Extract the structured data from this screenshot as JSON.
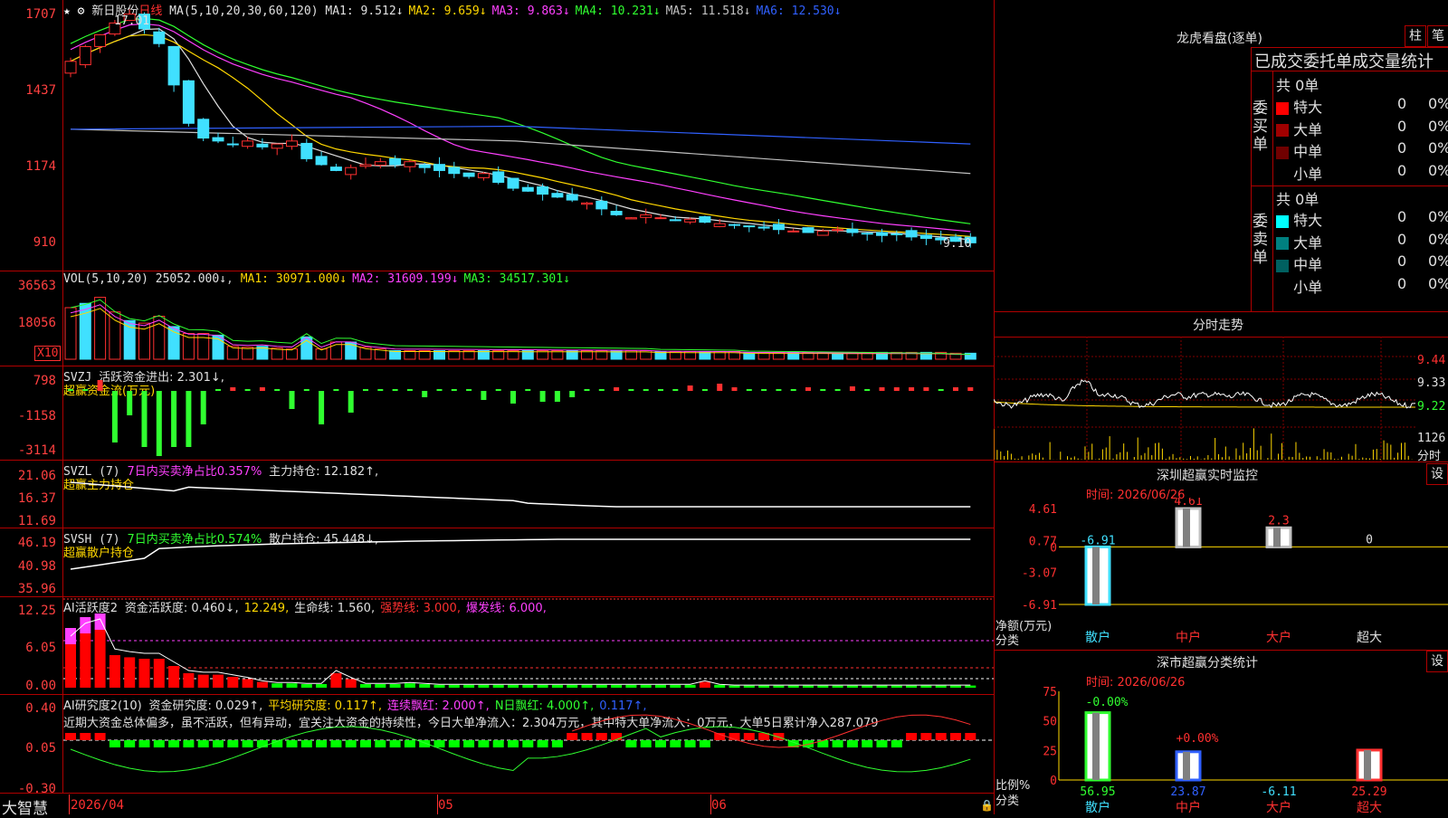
{
  "app_name": "大智慧",
  "stock": {
    "name": "新日股份",
    "period": "日线"
  },
  "kline": {
    "ma_params": "MA(5,10,20,30,60,120)",
    "ma_values": [
      {
        "label": "MA1:",
        "value": "9.512↓",
        "color": "#e0e0e0"
      },
      {
        "label": "MA2:",
        "value": "9.659↓",
        "color": "#ffd700"
      },
      {
        "label": "MA3:",
        "value": "9.863↓",
        "color": "#ff40ff"
      },
      {
        "label": "MA4:",
        "value": "10.231↓",
        "color": "#30ff30"
      },
      {
        "label": "MA5:",
        "value": "11.518↓",
        "color": "#c0c0c0"
      },
      {
        "label": "MA6:",
        "value": "12.530↓",
        "color": "#3060ff"
      }
    ],
    "y_ticks": [
      "1707",
      "1437",
      "1174",
      "910"
    ],
    "high_label": "17.01",
    "last_label": "9.10"
  },
  "vol": {
    "header": "VOL(5,10,20)",
    "value": "25052.000↓",
    "ma": [
      {
        "label": "MA1:",
        "value": "30971.000↓",
        "color": "#ffd700"
      },
      {
        "label": "MA2:",
        "value": "31609.199↓",
        "color": "#ff40ff"
      },
      {
        "label": "MA3:",
        "value": "34517.301↓",
        "color": "#30ff30"
      }
    ],
    "y_ticks": [
      "36563",
      "18056"
    ],
    "unit": "X10"
  },
  "svzj": {
    "header": "SVZJ",
    "desc": "活跃资金进出: 2.301↓,",
    "sub": "超赢资金流(万元)",
    "y_ticks": [
      "798",
      "-1158",
      "-3114"
    ]
  },
  "svzl": {
    "header": "SVZL (7)",
    "desc1": "7日内买卖净占比0.357%",
    "desc2": "主力持仓: 12.182↑,",
    "sub": "超赢主力持仓",
    "y_ticks": [
      "21.06",
      "16.37",
      "11.69"
    ]
  },
  "svsh": {
    "header": "SVSH (7)",
    "desc1": "7日内买卖净占比0.574%",
    "desc2": "散户持仓: 45.448↓,",
    "sub": "超赢散户持仓",
    "y_ticks": [
      "46.19",
      "40.98",
      "35.96"
    ]
  },
  "ai_active": {
    "header": "AI活跃度2",
    "items": [
      {
        "text": "资金活跃度: 0.460↓,",
        "color": "#e0e0e0"
      },
      {
        "text": "12.249,",
        "color": "#ffd700"
      },
      {
        "text": "生命线: 1.560,",
        "color": "#e0e0e0"
      },
      {
        "text": "强势线: 3.000,",
        "color": "#ff3030"
      },
      {
        "text": "爆发线: 6.000,",
        "color": "#ff40ff"
      }
    ],
    "y_ticks": [
      "12.25",
      "6.05",
      "0.00"
    ]
  },
  "ai_research": {
    "header": "AI研究度2(10)",
    "items": [
      {
        "text": "资金研究度: 0.029↑,",
        "color": "#e0e0e0"
      },
      {
        "text": "平均研究度: 0.117↑,",
        "color": "#ffd700"
      },
      {
        "text": "连续飘红: 2.000↑,",
        "color": "#ff40ff"
      },
      {
        "text": "N日飘红: 4.000↑,",
        "color": "#30ff30"
      },
      {
        "text": "0.117↑,",
        "color": "#3060ff"
      }
    ],
    "comment": "近期大资金总体偏多，虽不活跃，但有异动，宜关注大资金的持续性，今日大单净流入：2.304万元，其中特大单净流入：0万元，大单5日累计净入287.079",
    "y_ticks": [
      "0.40",
      "0.05",
      "-0.30"
    ]
  },
  "date_axis": [
    "2026/04",
    "05",
    "06"
  ],
  "right_panel": {
    "title": "龙虎看盘(逐单)",
    "btn_col": "柱",
    "btn_bi": "笔",
    "stats_title": "已成交委托单成交量统计",
    "buy": {
      "label": "委买单",
      "total": "共 0单",
      "rows": [
        {
          "name": "特大",
          "val": "0",
          "pct": "0%",
          "color": "#ff0000"
        },
        {
          "name": "大单",
          "val": "0",
          "pct": "0%",
          "color": "#a00000"
        },
        {
          "name": "中单",
          "val": "0",
          "pct": "0%",
          "color": "#700000"
        },
        {
          "name": "小单",
          "val": "0",
          "pct": "0%",
          "color": "#000000"
        }
      ]
    },
    "sell": {
      "label": "委卖单",
      "total": "共 0单",
      "rows": [
        {
          "name": "特大",
          "val": "0",
          "pct": "0%",
          "color": "#00ffff"
        },
        {
          "name": "大单",
          "val": "0",
          "pct": "0%",
          "color": "#008080"
        },
        {
          "name": "中单",
          "val": "0",
          "pct": "0%",
          "color": "#006060"
        },
        {
          "name": "小单",
          "val": "0",
          "pct": "0%",
          "color": "#000000"
        }
      ]
    },
    "intraday": {
      "title": "分时走势",
      "y_ticks": [
        "9.44",
        "9.33",
        "9.22"
      ],
      "vol_tick": "1126",
      "vol_unit": "分时"
    },
    "monitor": {
      "title": "深圳超赢实时监控",
      "btn": "设",
      "time": "时间: 2026/06/26",
      "y_ticks": [
        "4.61",
        "0.77",
        "0",
        "-3.07",
        "-6.91"
      ],
      "ylabel": "净额(万元)",
      "xlabel": "分类",
      "cats": [
        "散户",
        "中户",
        "大户",
        "超大"
      ],
      "values": [
        -6.91,
        4.61,
        2.3,
        0
      ],
      "value_labels": [
        "-6.91",
        "4.61",
        "2.3",
        "0"
      ]
    },
    "classify": {
      "title": "深市超赢分类统计",
      "btn": "设",
      "time": "时间: 2026/06/26",
      "y_ticks": [
        "75",
        "50",
        "25",
        "0"
      ],
      "ylabel": "比例%",
      "xlabel": "分类",
      "cats": [
        "散户",
        "中户",
        "大户",
        "超大"
      ],
      "values": [
        56.95,
        23.87,
        -6.11,
        25.29
      ],
      "value_labels": [
        "56.95",
        "23.87",
        "-6.11",
        "25.29"
      ],
      "change_labels": [
        "-0.00%",
        "+0.00%"
      ]
    }
  },
  "chart_data": [
    {
      "type": "line",
      "title": "新日股份 日线",
      "ylim": [
        9.1,
        17.01
      ],
      "x": [
        "2026/04",
        "05",
        "06"
      ],
      "series": [
        {
          "name": "MA1",
          "values": [
            9.512
          ]
        },
        {
          "name": "MA2",
          "values": [
            9.659
          ]
        },
        {
          "name": "MA3",
          "values": [
            9.863
          ]
        },
        {
          "name": "MA4",
          "values": [
            10.231
          ]
        },
        {
          "name": "MA5",
          "values": [
            11.518
          ]
        },
        {
          "name": "MA6",
          "values": [
            12.53
          ]
        }
      ]
    },
    {
      "type": "bar",
      "title": "深圳超赢实时监控",
      "categories": [
        "散户",
        "中户",
        "大户",
        "超大"
      ],
      "values": [
        -6.91,
        4.61,
        2.3,
        0
      ],
      "ylabel": "净额(万元)",
      "xlabel": "分类",
      "ylim": [
        -6.91,
        4.61
      ]
    },
    {
      "type": "bar",
      "title": "深市超赢分类统计",
      "categories": [
        "散户",
        "中户",
        "大户",
        "超大"
      ],
      "values": [
        56.95,
        23.87,
        -6.11,
        25.29
      ],
      "ylabel": "比例%",
      "xlabel": "分类",
      "ylim": [
        0,
        75
      ]
    }
  ]
}
